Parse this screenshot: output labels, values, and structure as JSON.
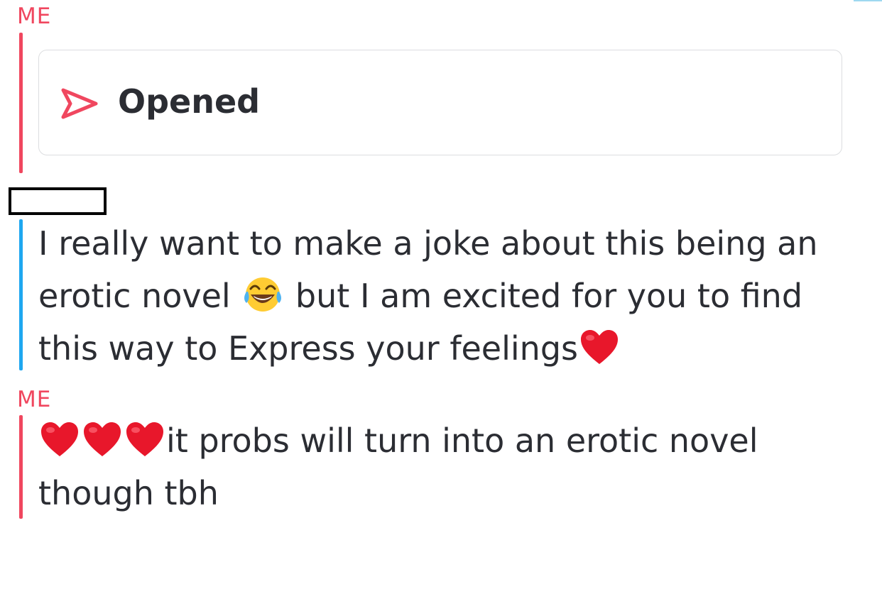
{
  "chat": {
    "sender_me_1": "ME",
    "opened_status": "Opened",
    "message_them": {
      "part1": "I really want to make a joke about this being an\nerotic novel ",
      "part2": " but I am excited for you to find\nthis way to Express your feelings"
    },
    "sender_me_2": "ME",
    "message_me": {
      "text": "it probs will turn into an erotic novel\nthough tbh"
    }
  },
  "icons": {
    "sent_arrow": "sent-arrow-icon",
    "laugh_emoji": "tears-of-joy-emoji",
    "heart_emoji": "red-heart-emoji"
  },
  "colors": {
    "me_accent": "#f0475f",
    "them_accent": "#1ea7f0",
    "text": "#2b2d33"
  }
}
